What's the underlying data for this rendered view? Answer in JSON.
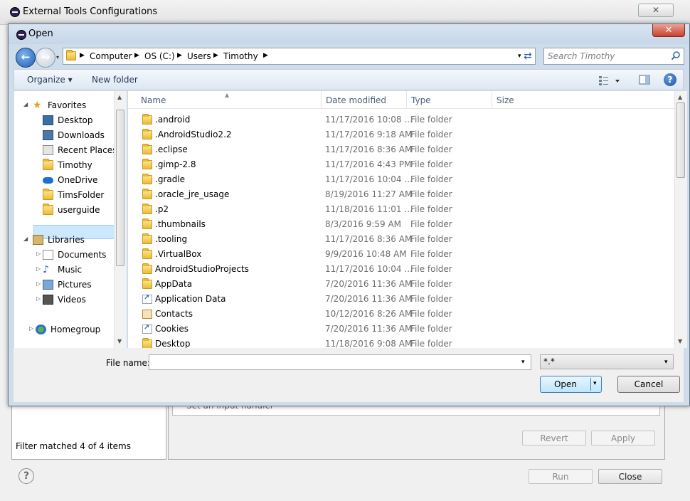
{
  "background_window": {
    "title": "External Tools Configurations",
    "close_symbol": "✕",
    "handler_text": "Set an input handler",
    "filter_status": "Filter matched 4 of 4 items",
    "help_symbol": "?",
    "buttons": {
      "revert": "Revert",
      "apply": "Apply",
      "run": "Run",
      "close": "Close"
    }
  },
  "open_dialog": {
    "title": "Open",
    "close_symbol": "✕",
    "nav": {
      "back_symbol": "←",
      "forward_symbol": "→",
      "history_dropdown": "▾",
      "refresh_symbol": "⇄"
    },
    "address": {
      "breadcrumbs": [
        "Computer",
        "OS (C:)",
        "Users",
        "Timothy"
      ],
      "arrow_symbol": "▶",
      "dropdown_symbol": "▾"
    },
    "search": {
      "placeholder": "Search Timothy"
    },
    "toolbar": {
      "organize": "Organize ▾",
      "new_folder": "New folder",
      "help_symbol": "?"
    },
    "nav_pane": {
      "favorites": {
        "label": "Favorites",
        "items": [
          "Desktop",
          "Downloads",
          "Recent Places",
          "Timothy",
          "OneDrive",
          "TimsFolder",
          "userguide"
        ]
      },
      "libraries": {
        "label": "Libraries",
        "items": [
          "Documents",
          "Music",
          "Pictures",
          "Videos"
        ]
      },
      "homegroup": {
        "label": "Homegroup"
      },
      "selected": "Timothy"
    },
    "columns": {
      "name": "Name",
      "date": "Date modified",
      "type": "Type",
      "size": "Size"
    },
    "files": [
      {
        "name": ".android",
        "date": "11/17/2016 10:08 ...",
        "type": "File folder",
        "icon": "folder"
      },
      {
        "name": ".AndroidStudio2.2",
        "date": "11/17/2016 9:18 AM",
        "type": "File folder",
        "icon": "folder"
      },
      {
        "name": ".eclipse",
        "date": "11/17/2016 8:36 AM",
        "type": "File folder",
        "icon": "folder"
      },
      {
        "name": ".gimp-2.8",
        "date": "11/17/2016 4:43 PM",
        "type": "File folder",
        "icon": "folder"
      },
      {
        "name": ".gradle",
        "date": "11/17/2016 10:04 ...",
        "type": "File folder",
        "icon": "folder"
      },
      {
        "name": ".oracle_jre_usage",
        "date": "8/19/2016 11:27 AM",
        "type": "File folder",
        "icon": "folder"
      },
      {
        "name": ".p2",
        "date": "11/18/2016 11:01 ...",
        "type": "File folder",
        "icon": "folder"
      },
      {
        "name": ".thumbnails",
        "date": "8/3/2016 9:59 AM",
        "type": "File folder",
        "icon": "folder"
      },
      {
        "name": ".tooling",
        "date": "11/17/2016 8:36 AM",
        "type": "File folder",
        "icon": "folder"
      },
      {
        "name": ".VirtualBox",
        "date": "9/9/2016 10:48 AM",
        "type": "File folder",
        "icon": "folder"
      },
      {
        "name": "AndroidStudioProjects",
        "date": "11/17/2016 10:04 ...",
        "type": "File folder",
        "icon": "folder"
      },
      {
        "name": "AppData",
        "date": "7/20/2016 11:36 AM",
        "type": "File folder",
        "icon": "folder"
      },
      {
        "name": "Application Data",
        "date": "7/20/2016 11:36 AM",
        "type": "File folder",
        "icon": "shortcut"
      },
      {
        "name": "Contacts",
        "date": "10/12/2016 8:26 AM",
        "type": "File folder",
        "icon": "contacts"
      },
      {
        "name": "Cookies",
        "date": "7/20/2016 11:36 AM",
        "type": "File folder",
        "icon": "shortcut"
      },
      {
        "name": "Desktop",
        "date": "11/18/2016 9:08 AM",
        "type": "File folder",
        "icon": "folder"
      }
    ],
    "file_name": {
      "label": "File name:",
      "value": "",
      "dropdown_symbol": "▾"
    },
    "file_type_filter": {
      "value": "*.*",
      "dropdown_symbol": "▾"
    },
    "buttons": {
      "open": "Open",
      "open_dropdown": "▾",
      "cancel": "Cancel"
    },
    "scroll_symbols": {
      "up": "▲",
      "down": "▼"
    }
  }
}
